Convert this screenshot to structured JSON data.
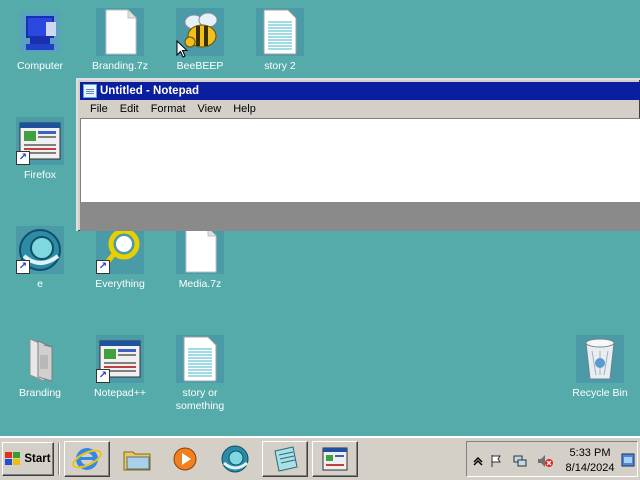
{
  "desktop": {
    "icons": [
      {
        "label": "Computer"
      },
      {
        "label": "Branding.7z"
      },
      {
        "label": "BeeBEEP"
      },
      {
        "label": "story 2"
      },
      {
        "label": "Firefox"
      },
      {
        "label": "e"
      },
      {
        "label": "Everything"
      },
      {
        "label": "Media.7z"
      },
      {
        "label": "Branding"
      },
      {
        "label": "Notepad++"
      },
      {
        "label": "story or something"
      },
      {
        "label": "Recycle Bin"
      }
    ]
  },
  "notepad": {
    "title": "Untitled - Notepad",
    "menu": [
      "File",
      "Edit",
      "Format",
      "View",
      "Help"
    ],
    "content": ""
  },
  "taskbar": {
    "start_label": "Start",
    "pinned": [
      {
        "icon": "internet-explorer-icon"
      },
      {
        "icon": "folder-icon"
      },
      {
        "icon": "media-player-icon"
      },
      {
        "icon": "browser-icon"
      },
      {
        "icon": "notepad-icon"
      },
      {
        "icon": "app-window-icon"
      }
    ],
    "tray": {
      "time": "5:33 PM",
      "date": "8/14/2024"
    }
  },
  "colors": {
    "desktop": "#55aaaa",
    "titlebar": "#0a1ea0",
    "taskbar": "#d4d0c8"
  }
}
